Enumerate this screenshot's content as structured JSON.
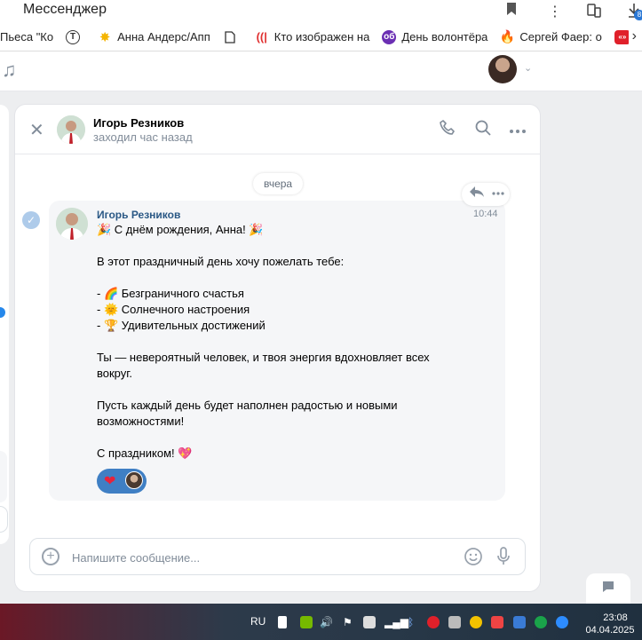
{
  "browser": {
    "tab_title": "Мессенджер",
    "bookmarks": [
      {
        "label": "Пьеса \"Ко",
        "icon": "none"
      },
      {
        "label": "",
        "icon": "t-circle-icon"
      },
      {
        "label": "Анна Андерс/Апп",
        "icon": "star-icon"
      },
      {
        "label": "",
        "icon": "document-icon"
      },
      {
        "label": "Кто изображен на",
        "icon": "audio-wave-icon"
      },
      {
        "label": "День волонтёра",
        "icon": "ob-icon"
      },
      {
        "label": "Сергей Фаер: о",
        "icon": "flame-icon"
      },
      {
        "label": "",
        "icon": "ozon-icon"
      }
    ],
    "download_badge": "8"
  },
  "chat": {
    "peer_name": "Игорь Резников",
    "peer_status": "заходил час назад",
    "date_separator": "вчера",
    "message": {
      "author": "Игорь Резников",
      "time": "10:44",
      "lines": [
        "🎉 С днём рождения, Анна! 🎉",
        "В этот праздничный день хочу пожелать тебе:",
        "- 🌈 Безграничного счастья",
        "- 🌞 Солнечного настроения",
        "- 🏆 Удивительных достижений",
        "Ты — невероятный человек, и твоя энергия вдохновляет всех",
        "вокруг.",
        "Пусть каждый день будет наполнен радостью и новыми",
        "возможностями!",
        "С праздником! 💖"
      ],
      "reaction": "❤"
    },
    "composer_placeholder": "Напишите сообщение..."
  },
  "taskbar": {
    "language": "RU",
    "time": "23:08",
    "date": "04.04.2025"
  }
}
